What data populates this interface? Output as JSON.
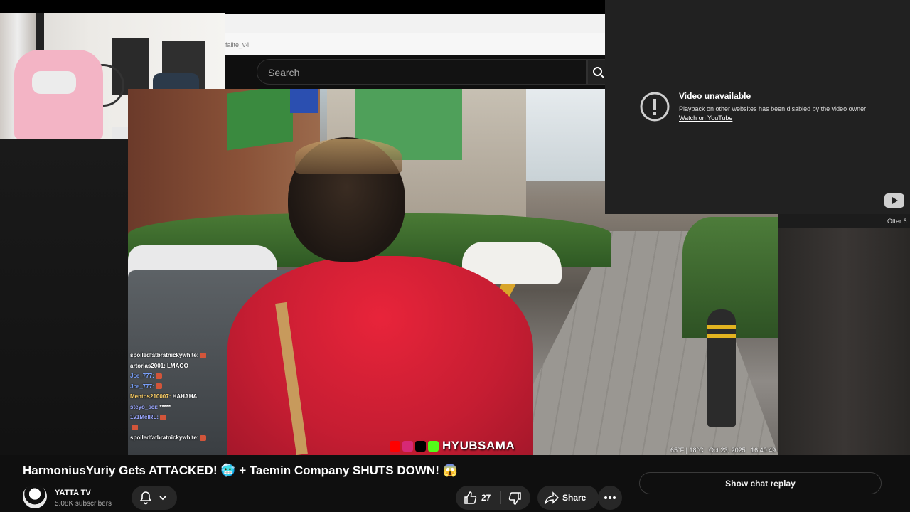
{
  "browser": {
    "address_text": "fallte_v4"
  },
  "youtube_header": {
    "search_placeholder": "Search"
  },
  "chat": [
    {
      "user": "spoiledfatbratnickywhite:",
      "user_color": "#ffffff",
      "message": "",
      "emote": true
    },
    {
      "user": "artorias2001:",
      "user_color": "#ffffff",
      "message": "LMAOO",
      "emote": false
    },
    {
      "user": "Jce_777:",
      "user_color": "#7aa2ff",
      "message": "",
      "emote": true
    },
    {
      "user": "Jce_777:",
      "user_color": "#7aa2ff",
      "message": "",
      "emote": true
    },
    {
      "user": "Mentos210007:",
      "user_color": "#ffd166",
      "message": "HAHAHA",
      "emote": false
    },
    {
      "user": "steyo_sci:",
      "user_color": "#9aa7ff",
      "message": "*****",
      "emote": false
    },
    {
      "user": "1v1MeIRL:",
      "user_color": "#9aa7ff",
      "message": "",
      "emote": true
    },
    {
      "user": "",
      "user_color": "#9aa7ff",
      "message": "",
      "emote": true
    },
    {
      "user": "spoiledfatbratnickywhite:",
      "user_color": "#ffffff",
      "message": "",
      "emote": true
    }
  ],
  "watermark": {
    "text": "HYUBSAMA",
    "icons": [
      {
        "name": "youtube-icon",
        "color": "#ff0000"
      },
      {
        "name": "instagram-icon",
        "color": "#d62976"
      },
      {
        "name": "x-icon",
        "color": "#000000"
      },
      {
        "name": "kick-icon",
        "color": "#53fc18"
      }
    ]
  },
  "timestamp": "65°F | 18°C   Oct 23, 2025   16:40:49",
  "embed": {
    "title": "Video unavailable",
    "description": "Playback on websites has been disabled by the video owner",
    "description_full": "Playback on other websites has been disabled by the video owner",
    "link": "Watch on YouTube",
    "other_label": "Otter 6"
  },
  "video_info": {
    "title": "HarmoniusYuriy Gets ATTACKED! 🥶 + Taemin Company SHUTS DOWN! 😱",
    "channel": "YATTA TV",
    "subscribers": "5.08K subscribers",
    "likes": "27",
    "share_label": "Share",
    "chat_replay_label": "Show chat replay"
  }
}
